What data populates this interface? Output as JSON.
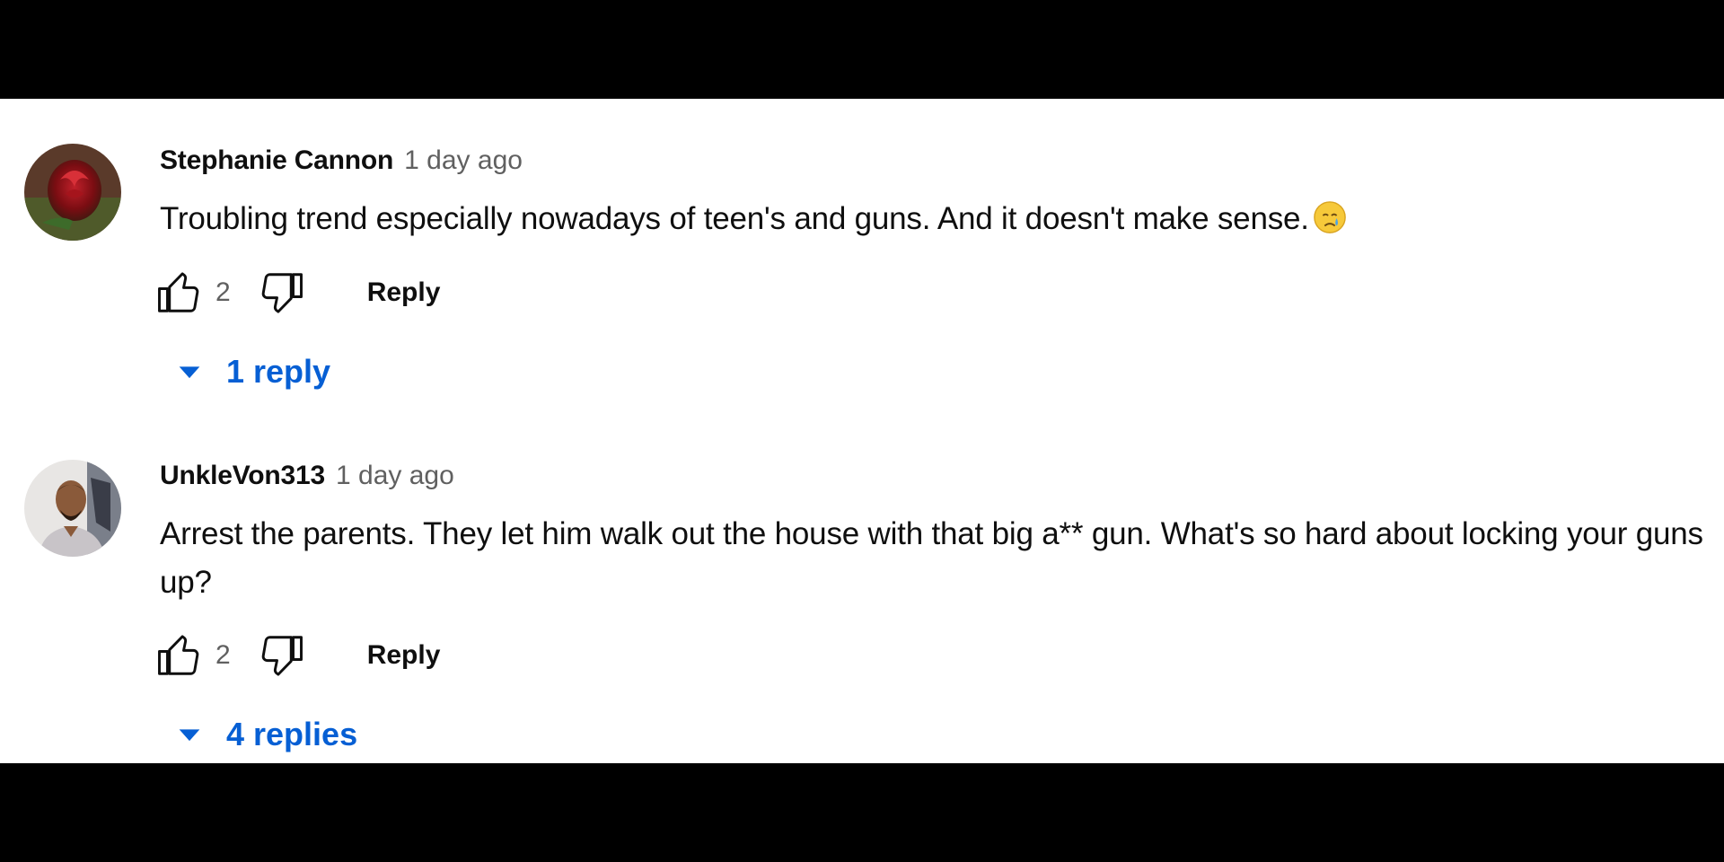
{
  "comments": [
    {
      "author": "Stephanie Cannon",
      "time": "1 day ago",
      "text": "Troubling trend especially nowadays of teen's and guns.  And it doesn't make sense.",
      "emoji": "crying-face-icon",
      "likes": "2",
      "reply_label": "Reply",
      "replies_label": "1 reply",
      "avatar": "rose-avatar"
    },
    {
      "author": "UnkleVon313",
      "time": "1 day ago",
      "text": "Arrest the parents. They let him walk out the house with that big a** gun. What's so hard about locking your guns up?",
      "likes": "2",
      "reply_label": "Reply",
      "replies_label": "4 replies",
      "avatar": "man-portrait-avatar"
    }
  ],
  "colors": {
    "link_blue": "#065fd4",
    "secondary_text": "#606060",
    "primary_text": "#0f0f0f"
  }
}
